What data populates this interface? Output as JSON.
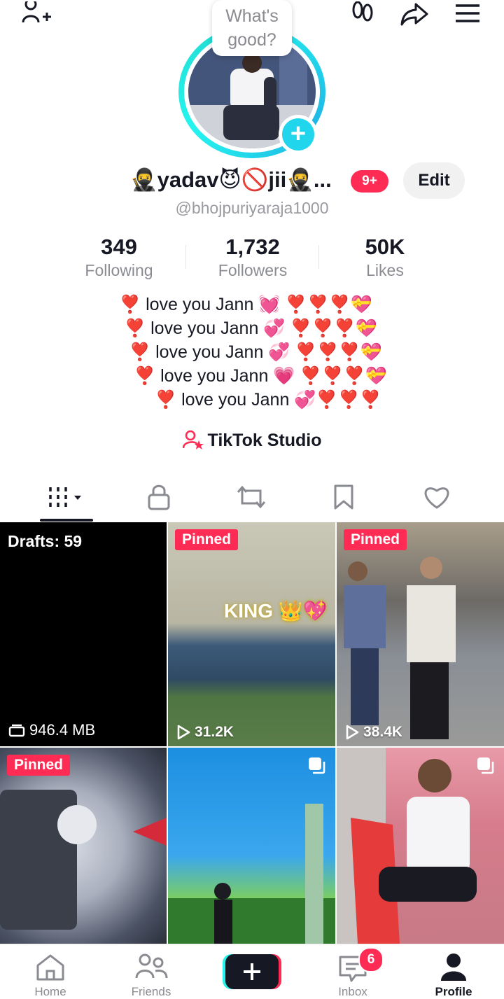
{
  "top_bar": {
    "add_friend_icon": "person-add-icon",
    "footprints_icon": "footprints-icon",
    "share_icon": "share-arrow-icon",
    "menu_icon": "hamburger-menu-icon"
  },
  "profile": {
    "note_bubble": "What's good?",
    "display_name": "🥷yadav😈🚫jii🥷...",
    "notification_badge": "9+",
    "edit_label": "Edit",
    "handle": "@bhojpuriyaraja1000",
    "stats": [
      {
        "value": "349",
        "label": "Following"
      },
      {
        "value": "1,732",
        "label": "Followers"
      },
      {
        "value": "50K",
        "label": "Likes"
      }
    ],
    "bio_lines": [
      "❣️ love you Jann 💓 ❣️❣️❣️💝",
      "❣️ love you Jann 💞 ❣️❣️❣️💝",
      "❣️ love you Jann 💞 ❣️❣️❣️💝",
      "❣️ love you Jann 💗 ❣️❣️❣️💝",
      "❣️ love you Jann 💞❣️❣️❣️"
    ],
    "studio_label": "TikTok Studio"
  },
  "tabs": [
    {
      "icon": "grid-icon",
      "active": true
    },
    {
      "icon": "lock-icon",
      "active": false
    },
    {
      "icon": "repost-icon",
      "active": false
    },
    {
      "icon": "bookmark-icon",
      "active": false
    },
    {
      "icon": "heart-icon",
      "active": false
    }
  ],
  "videos": {
    "drafts_label": "Drafts: 59",
    "drafts_size": "946.4 MB",
    "pinned_label": "Pinned",
    "items": [
      {
        "pinned": true,
        "views": "31.2K",
        "overlay_text": "KING 👑💖"
      },
      {
        "pinned": true,
        "views": "38.4K"
      },
      {
        "pinned": true
      },
      {
        "pinned": false,
        "multi": true
      },
      {
        "pinned": false,
        "multi": true
      }
    ]
  },
  "bottom_nav": {
    "items": [
      {
        "label": "Home",
        "icon": "home-icon"
      },
      {
        "label": "Friends",
        "icon": "friends-icon"
      },
      {
        "label": "",
        "icon": "create-plus-icon"
      },
      {
        "label": "Inbox",
        "icon": "inbox-icon",
        "badge": "6"
      },
      {
        "label": "Profile",
        "icon": "profile-icon",
        "active": true
      }
    ]
  },
  "colors": {
    "accent_red": "#fe2c55",
    "accent_cyan": "#25f4ee",
    "text_primary": "#161823",
    "text_secondary": "#8a8b91"
  }
}
